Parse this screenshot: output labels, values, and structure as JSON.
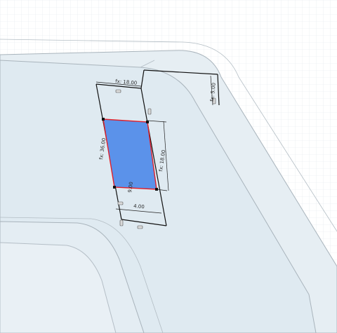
{
  "viewport": {
    "background": "#ffffff",
    "grid_color": "#d7dde3",
    "body_fill": "#dfeaf1",
    "body_edge": "#a9b4bc",
    "sketch_line": "#111111"
  },
  "sketch": {
    "selected_profile": {
      "fill": "#5b92ea",
      "edge": "#e0202a"
    },
    "dimensions": [
      {
        "id": "top-width",
        "text": "fx: 18.00"
      },
      {
        "id": "offset",
        "text": "fx: 5.00"
      },
      {
        "id": "left-length",
        "text": "fx: 36.00"
      },
      {
        "id": "right-length",
        "text": "fx: 18.00"
      },
      {
        "id": "bottom-length",
        "text": "9.00"
      },
      {
        "id": "bottom-width",
        "text": "4.00"
      }
    ],
    "constraints": [
      "horizontal",
      "vertical",
      "horizontal",
      "vertical",
      "horizontal",
      "vertical"
    ]
  }
}
